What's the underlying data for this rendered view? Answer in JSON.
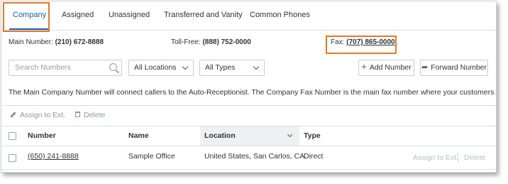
{
  "tabs": [
    {
      "label": "Company",
      "active": true
    },
    {
      "label": "Assigned"
    },
    {
      "label": "Unassigned"
    },
    {
      "label": "Transferred and Vanity"
    },
    {
      "label": "Common Phones"
    }
  ],
  "numbers": {
    "main_label": "Main Number:",
    "main_value": "(210) 672-8888",
    "tollfree_label": "Toll-Free:",
    "tollfree_value": "(888) 752-0000",
    "fax_label": "Fax:",
    "fax_value": "(707) 865-0000"
  },
  "filters": {
    "search_placeholder": "Search Numbers",
    "locations": "All Locations",
    "types": "All Types"
  },
  "buttons": {
    "add": "Add Number",
    "forward": "Forward Number"
  },
  "description": "The Main Company Number will connect callers to the Auto-Receptionist. The Company Fax Number is the main fax number where your customers can send faxes.",
  "bulk_actions": {
    "assign": "Assign to Ext.",
    "delete": "Delete"
  },
  "table": {
    "headers": {
      "number": "Number",
      "name": "Name",
      "location": "Location",
      "type": "Type"
    },
    "rows": [
      {
        "number": "(650) 241-8888",
        "name": "Sample Office",
        "location": "United States, San Carlos, CA",
        "type": "Direct",
        "assign": "Assign to Ext.",
        "delete": "Delete"
      }
    ]
  },
  "colors": {
    "accent": "#1a5fa8",
    "highlight": "#e07b24"
  }
}
